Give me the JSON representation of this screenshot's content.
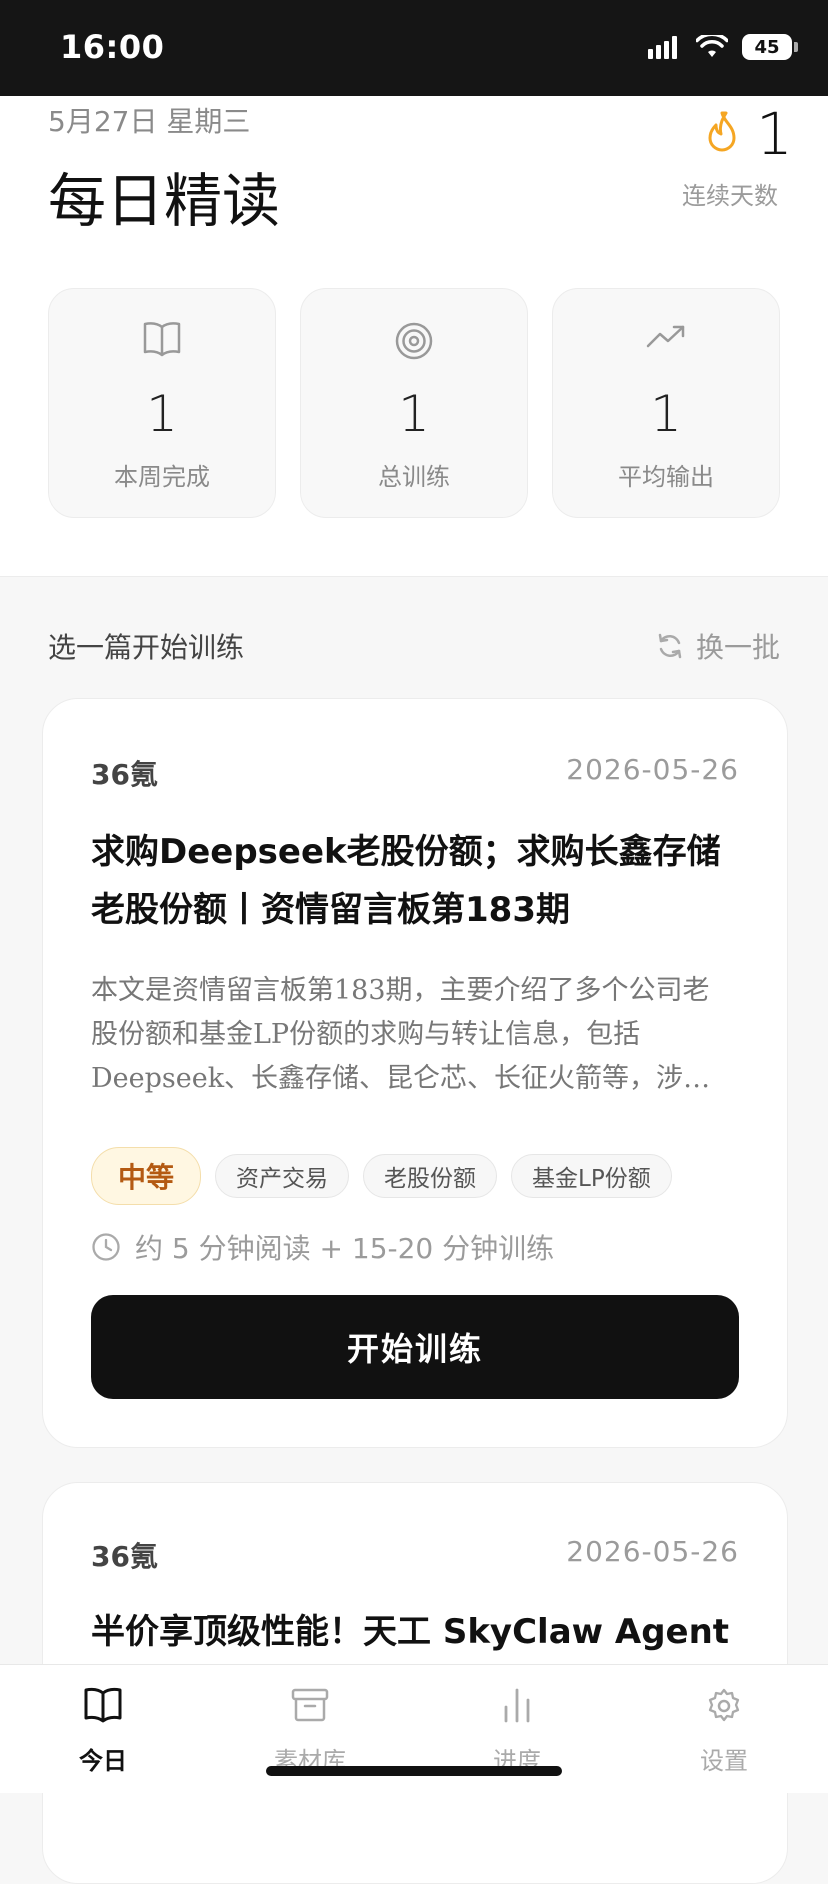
{
  "status_bar": {
    "time": "16:00",
    "battery": "45"
  },
  "header": {
    "date": "5月27日 星期三",
    "title": "每日精读",
    "streak": {
      "value": "1",
      "label": "连续天数",
      "icon": "flame-icon"
    }
  },
  "stats": [
    {
      "icon": "book-icon",
      "value": "1",
      "label": "本周完成"
    },
    {
      "icon": "target-icon",
      "value": "1",
      "label": "总训练"
    },
    {
      "icon": "trend-up-icon",
      "value": "1",
      "label": "平均输出"
    }
  ],
  "section": {
    "title": "选一篇开始训练",
    "refresh_label": "换一批"
  },
  "articles": [
    {
      "source": "36氪",
      "date": "2026-05-26",
      "title": "求购Deepseek老股份额；求购长鑫存储老股份额丨资情留言板第183期",
      "summary": "本文是资情留言板第183期，主要介绍了多个公司老股份额和基金LP份额的求购与转让信息，包括Deepseek、长鑫存储、昆仑芯、长征火箭等，涉及多个行业",
      "difficulty": "中等",
      "tags": [
        "资产交易",
        "老股份额",
        "基金LP份额"
      ],
      "duration": "约 5 分钟阅读 + 15-20 分钟训练",
      "button_label": "开始训练"
    },
    {
      "source": "36氪",
      "date": "2026-05-26",
      "title": "半价享顶级性能！天工 SkyClaw Agent"
    }
  ],
  "tab_bar": [
    {
      "icon": "book-icon",
      "label": "今日",
      "active": true
    },
    {
      "icon": "archive-icon",
      "label": "素材库",
      "active": false
    },
    {
      "icon": "bar-chart-icon",
      "label": "进度",
      "active": false
    },
    {
      "icon": "gear-icon",
      "label": "设置",
      "active": false
    }
  ],
  "colors": {
    "accent_flame": "#f5a623",
    "difficulty_text": "#b45a12",
    "button_bg": "#111111"
  }
}
